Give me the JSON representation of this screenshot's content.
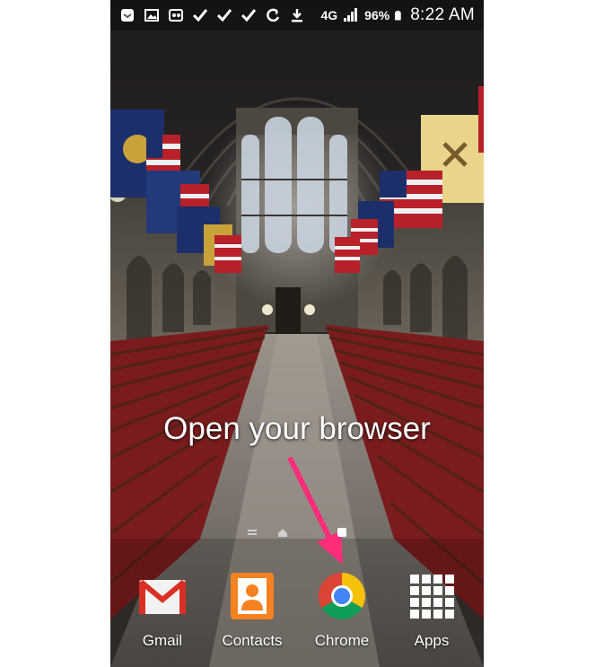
{
  "status_bar": {
    "battery_percent": "96%",
    "time": "8:22 AM",
    "network": "4G",
    "left_icons": [
      "notification-icon",
      "gallery-icon",
      "voicemail-icon",
      "check-icon",
      "check-icon",
      "check-icon",
      "sync-icon",
      "download-icon"
    ]
  },
  "instruction": {
    "text": "Open your browser",
    "arrow_color": "#ff2d7a"
  },
  "home_pages": {
    "count": 3,
    "current": 3
  },
  "dock": {
    "apps": [
      {
        "label": "Gmail",
        "icon": "gmail-icon"
      },
      {
        "label": "Contacts",
        "icon": "contacts-icon"
      },
      {
        "label": "Chrome",
        "icon": "chrome-icon"
      },
      {
        "label": "Apps",
        "icon": "apps-grid-icon"
      }
    ]
  },
  "colors": {
    "contacts_orange": "#f58220",
    "chrome_red": "#db4437",
    "chrome_yellow": "#f4c20d",
    "chrome_green": "#0f9d58",
    "chrome_blue": "#4285f4",
    "gmail_red": "#d93025"
  }
}
